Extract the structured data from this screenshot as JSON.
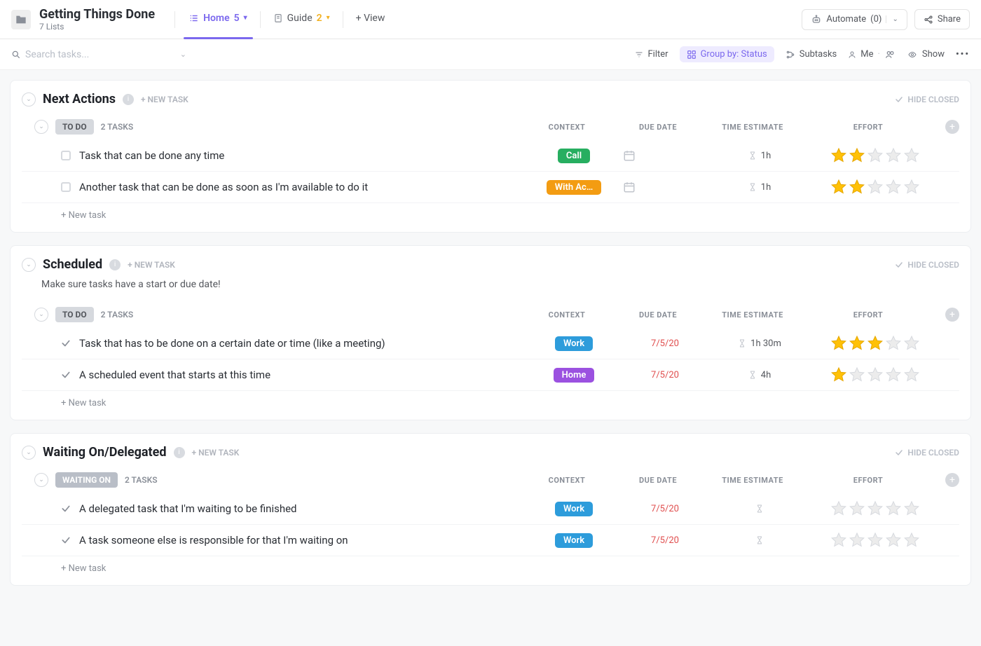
{
  "space": {
    "title": "Getting Things Done",
    "subtitle": "7 Lists"
  },
  "tabs": {
    "home": {
      "label": "Home",
      "count": "5"
    },
    "guide": {
      "label": "Guide",
      "count": "2"
    },
    "addView": "+ View"
  },
  "nav": {
    "automate": {
      "label": "Automate",
      "count": "(0)"
    },
    "share": "Share"
  },
  "toolbar": {
    "searchPlaceholder": "Search tasks...",
    "filter": "Filter",
    "groupBy": "Group by: Status",
    "subtasks": "Subtasks",
    "me": "Me",
    "show": "Show"
  },
  "columnHeaders": {
    "context": "CONTEXT",
    "due": "DUE DATE",
    "time": "TIME ESTIMATE",
    "effort": "EFFORT"
  },
  "misc": {
    "newTaskHeader": "+ NEW TASK",
    "newTaskRow": "+ New task",
    "hideClosed": "HIDE CLOSED"
  },
  "contextColors": {
    "Call": "#27ae60",
    "With Ac…": "#f39c12",
    "Work": "#2d9cdb",
    "Home": "#9b51e0"
  },
  "sections": [
    {
      "title": "Next Actions",
      "note": "",
      "groups": [
        {
          "status": "TO DO",
          "statusStyle": "todo",
          "count": "2 TASKS",
          "tasks": [
            {
              "done": false,
              "title": "Task that can be done any time",
              "context": "Call",
              "due": "",
              "time": "1h",
              "effort": 2
            },
            {
              "done": false,
              "title": "Another task that can be done as soon as I'm available to do it",
              "context": "With Ac…",
              "due": "",
              "time": "1h",
              "effort": 2
            }
          ]
        }
      ]
    },
    {
      "title": "Scheduled",
      "note": "Make sure tasks have a start or due date!",
      "groups": [
        {
          "status": "TO DO",
          "statusStyle": "todo",
          "count": "2 TASKS",
          "tasks": [
            {
              "done": true,
              "title": "Task that has to be done on a certain date or time (like a meeting)",
              "context": "Work",
              "due": "7/5/20",
              "time": "1h 30m",
              "effort": 3
            },
            {
              "done": true,
              "title": "A scheduled event that starts at this time",
              "context": "Home",
              "due": "7/5/20",
              "time": "4h",
              "effort": 1
            }
          ]
        }
      ]
    },
    {
      "title": "Waiting On/Delegated",
      "note": "",
      "groups": [
        {
          "status": "WAITING ON",
          "statusStyle": "waiting",
          "count": "2 TASKS",
          "tasks": [
            {
              "done": true,
              "title": "A delegated task that I'm waiting to be finished",
              "context": "Work",
              "due": "7/5/20",
              "time": "",
              "effort": 0
            },
            {
              "done": true,
              "title": "A task someone else is responsible for that I'm waiting on",
              "context": "Work",
              "due": "7/5/20",
              "time": "",
              "effort": 0
            }
          ]
        }
      ]
    }
  ]
}
